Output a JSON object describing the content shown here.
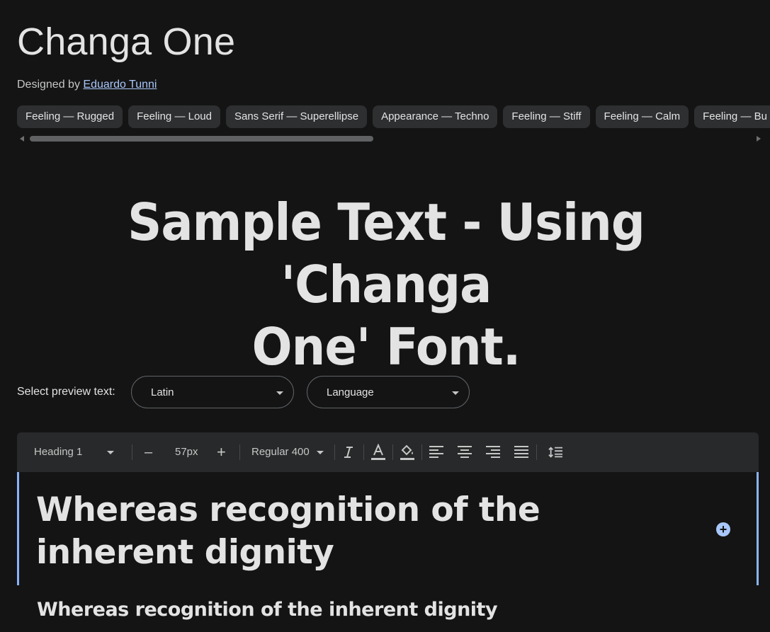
{
  "font": {
    "name": "Changa One",
    "designed_by_label": "Designed by",
    "designer": "Eduardo Tunni"
  },
  "tags": [
    "Feeling — Rugged",
    "Feeling — Loud",
    "Sans Serif — Superellipse",
    "Appearance — Techno",
    "Feeling — Stiff",
    "Feeling — Calm",
    "Feeling — Bu"
  ],
  "hero": {
    "line1": "Sample Text - Using 'Changa",
    "line2": "One' Font."
  },
  "preview": {
    "label": "Select preview text:",
    "script_value": "Latin",
    "language_value": "Language"
  },
  "toolbar": {
    "style_value": "Heading 1",
    "decrease_label": "–",
    "size_value": "57px",
    "increase_label": "+",
    "weight_value": "Regular 400",
    "icons": [
      "italic-icon",
      "text-color-icon",
      "highlight-fill-icon",
      "align-left-icon",
      "align-center-icon",
      "align-right-icon",
      "align-justify-icon",
      "line-spacing-icon"
    ]
  },
  "editor": {
    "text": "Whereas recognition of the inherent dignity",
    "add_label": "+"
  },
  "secondary_sample": "Whereas recognition of the inherent dignity",
  "colors": {
    "background": "#141414",
    "accent": "#8ab4f8",
    "link": "#a8c7fa",
    "chip": "#2d2f31"
  }
}
